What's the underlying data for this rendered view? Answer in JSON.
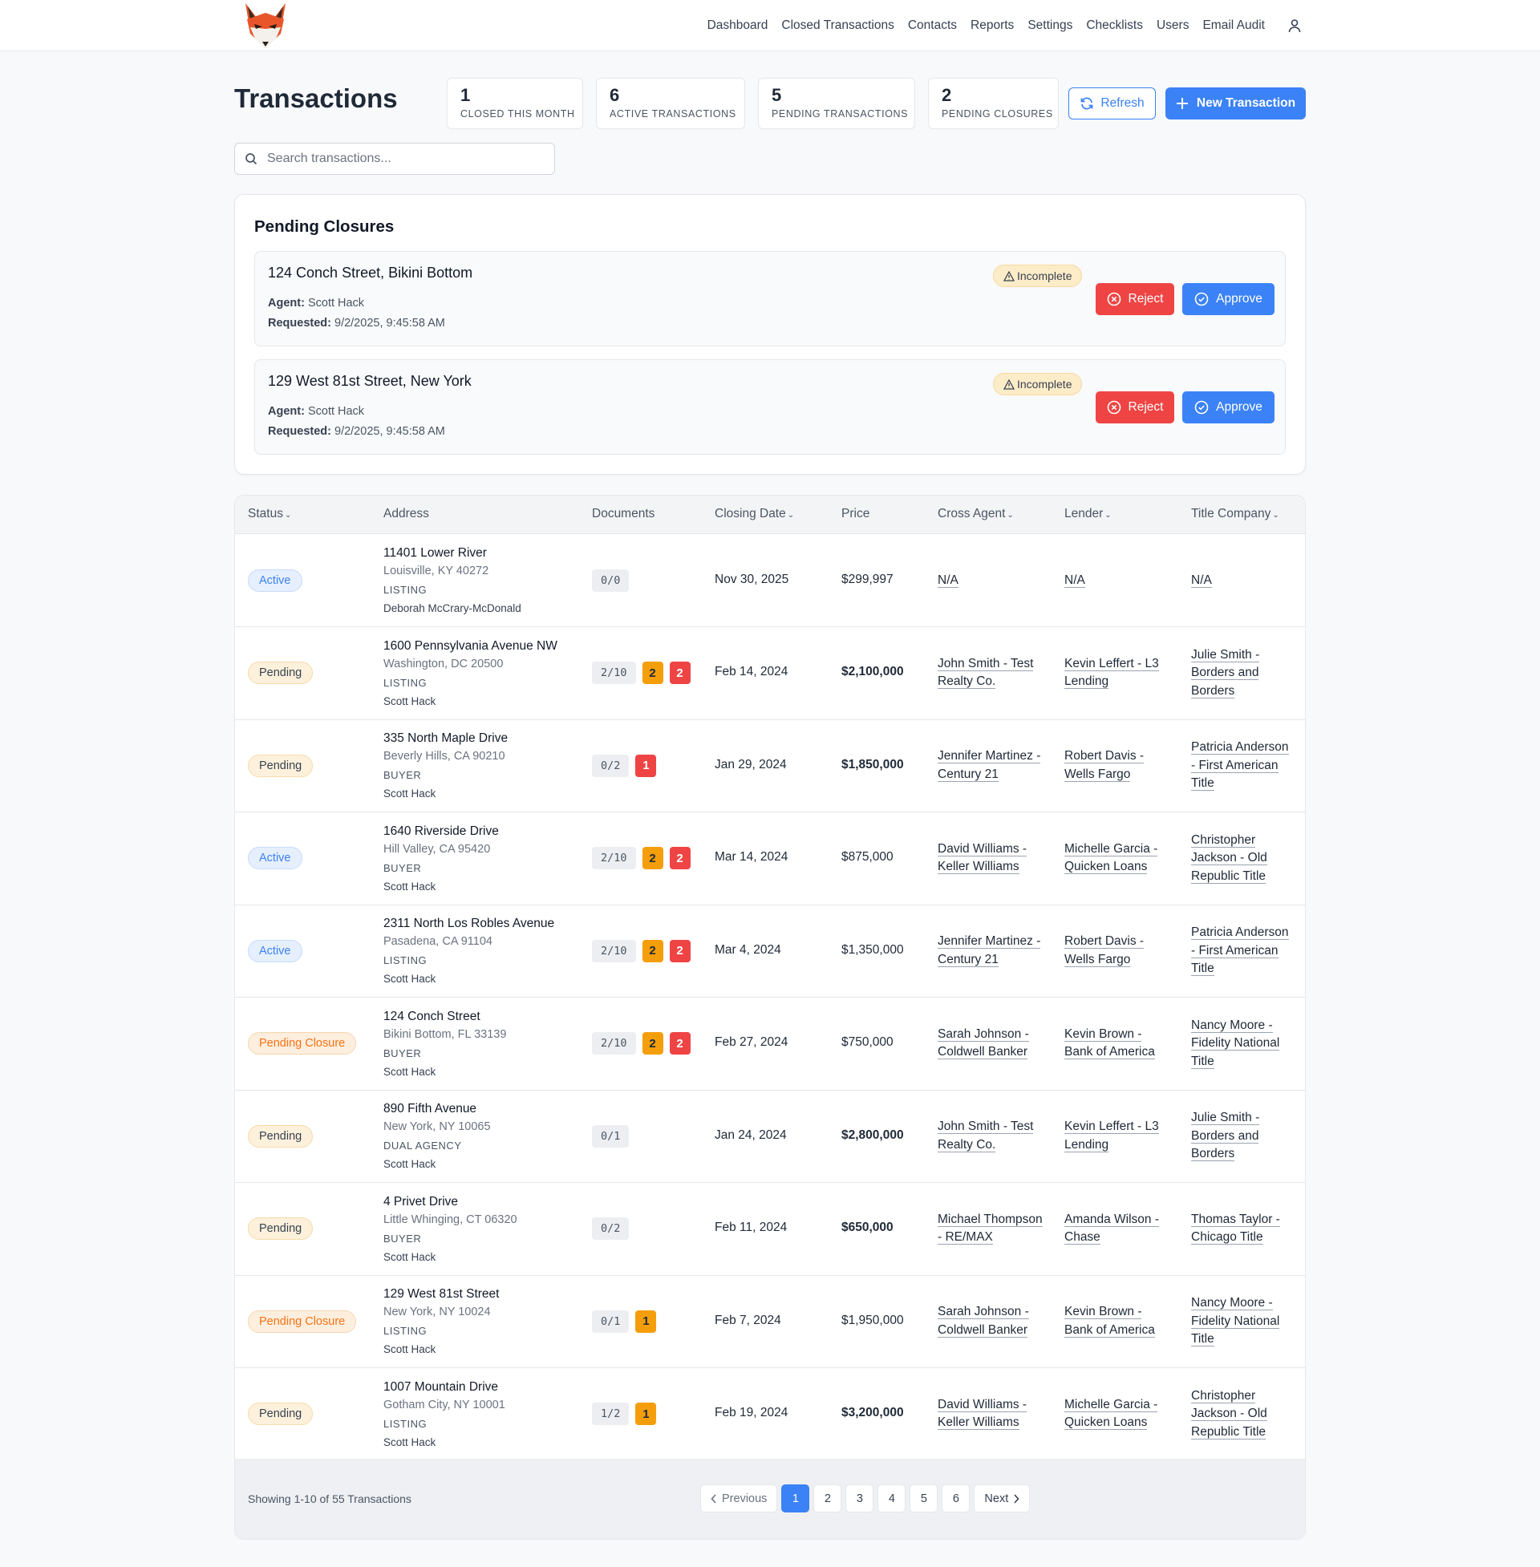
{
  "nav": {
    "items": [
      "Dashboard",
      "Closed Transactions",
      "Contacts",
      "Reports",
      "Settings",
      "Checklists",
      "Users",
      "Email Audit"
    ]
  },
  "header": {
    "title": "Transactions",
    "stats": [
      {
        "num": "1",
        "label": "CLOSED THIS MONTH"
      },
      {
        "num": "6",
        "label": "ACTIVE TRANSACTIONS"
      },
      {
        "num": "5",
        "label": "PENDING TRANSACTIONS"
      },
      {
        "num": "2",
        "label": "PENDING CLOSURES"
      }
    ],
    "refresh_label": "Refresh",
    "new_label": "New Transaction"
  },
  "search": {
    "placeholder": "Search transactions..."
  },
  "pending_closures": {
    "title": "Pending Closures",
    "agent_label": "Agent:",
    "requested_label": "Requested:",
    "badge": "Incomplete",
    "reject_label": "Reject",
    "approve_label": "Approve",
    "items": [
      {
        "address": "124 Conch Street, Bikini Bottom",
        "agent": "Scott Hack",
        "requested": "9/2/2025, 9:45:58 AM"
      },
      {
        "address": "129 West 81st Street, New York",
        "agent": "Scott Hack",
        "requested": "9/2/2025, 9:45:58 AM"
      }
    ]
  },
  "table": {
    "columns": [
      "Status",
      "Address",
      "Documents",
      "Closing Date",
      "Price",
      "Cross Agent",
      "Lender",
      "Title Company"
    ],
    "rows": [
      {
        "status": "Active",
        "addr1": "11401 Lower River",
        "addr2": "Louisville, KY 40272",
        "type": "LISTING",
        "agent": "Deborah McCrary-McDonald",
        "docs": "0/0",
        "orange": "",
        "red": "",
        "date": "Nov 30, 2025",
        "price": "$299,997",
        "bold": false,
        "cross": "N/A",
        "lender": "N/A",
        "title": "N/A"
      },
      {
        "status": "Pending",
        "addr1": "1600 Pennsylvania Avenue NW",
        "addr2": "Washington, DC 20500",
        "type": "LISTING",
        "agent": "Scott Hack",
        "docs": "2/10",
        "orange": "2",
        "red": "2",
        "date": "Feb 14, 2024",
        "price": "$2,100,000",
        "bold": true,
        "cross": "John Smith - Test Realty Co.",
        "lender": "Kevin Leffert - L3 Lending",
        "title": "Julie Smith - Borders and Borders"
      },
      {
        "status": "Pending",
        "addr1": "335 North Maple Drive",
        "addr2": "Beverly Hills, CA 90210",
        "type": "BUYER",
        "agent": "Scott Hack",
        "docs": "0/2",
        "orange": "",
        "red": "1",
        "date": "Jan 29, 2024",
        "price": "$1,850,000",
        "bold": true,
        "cross": "Jennifer Martinez - Century 21",
        "lender": "Robert Davis - Wells Fargo",
        "title": "Patricia Anderson - First American Title"
      },
      {
        "status": "Active",
        "addr1": "1640 Riverside Drive",
        "addr2": "Hill Valley, CA 95420",
        "type": "BUYER",
        "agent": "Scott Hack",
        "docs": "2/10",
        "orange": "2",
        "red": "2",
        "date": "Mar 14, 2024",
        "price": "$875,000",
        "bold": false,
        "cross": "David Williams - Keller Williams",
        "lender": "Michelle Garcia - Quicken Loans",
        "title": "Christopher Jackson - Old Republic Title"
      },
      {
        "status": "Active",
        "addr1": "2311 North Los Robles Avenue",
        "addr2": "Pasadena, CA 91104",
        "type": "LISTING",
        "agent": "Scott Hack",
        "docs": "2/10",
        "orange": "2",
        "red": "2",
        "date": "Mar 4, 2024",
        "price": "$1,350,000",
        "bold": false,
        "cross": "Jennifer Martinez - Century 21",
        "lender": "Robert Davis - Wells Fargo",
        "title": "Patricia Anderson - First American Title"
      },
      {
        "status": "Pending Closure",
        "addr1": "124 Conch Street",
        "addr2": "Bikini Bottom, FL 33139",
        "type": "BUYER",
        "agent": "Scott Hack",
        "docs": "2/10",
        "orange": "2",
        "red": "2",
        "date": "Feb 27, 2024",
        "price": "$750,000",
        "bold": false,
        "cross": "Sarah Johnson - Coldwell Banker",
        "lender": "Kevin Brown - Bank of America",
        "title": "Nancy Moore - Fidelity National Title"
      },
      {
        "status": "Pending",
        "addr1": "890 Fifth Avenue",
        "addr2": "New York, NY 10065",
        "type": "DUAL AGENCY",
        "agent": "Scott Hack",
        "docs": "0/1",
        "orange": "",
        "red": "",
        "date": "Jan 24, 2024",
        "price": "$2,800,000",
        "bold": true,
        "cross": "John Smith - Test Realty Co.",
        "lender": "Kevin Leffert - L3 Lending",
        "title": "Julie Smith - Borders and Borders"
      },
      {
        "status": "Pending",
        "addr1": "4 Privet Drive",
        "addr2": "Little Whinging, CT 06320",
        "type": "BUYER",
        "agent": "Scott Hack",
        "docs": "0/2",
        "orange": "",
        "red": "",
        "date": "Feb 11, 2024",
        "price": "$650,000",
        "bold": true,
        "cross": "Michael Thompson - RE/MAX",
        "lender": "Amanda Wilson - Chase",
        "title": "Thomas Taylor - Chicago Title"
      },
      {
        "status": "Pending Closure",
        "addr1": "129 West 81st Street",
        "addr2": "New York, NY 10024",
        "type": "LISTING",
        "agent": "Scott Hack",
        "docs": "0/1",
        "orange": "1",
        "red": "",
        "date": "Feb 7, 2024",
        "price": "$1,950,000",
        "bold": false,
        "cross": "Sarah Johnson - Coldwell Banker",
        "lender": "Kevin Brown - Bank of America",
        "title": "Nancy Moore - Fidelity National Title"
      },
      {
        "status": "Pending",
        "addr1": "1007 Mountain Drive",
        "addr2": "Gotham City, NY 10001",
        "type": "LISTING",
        "agent": "Scott Hack",
        "docs": "1/2",
        "orange": "1",
        "red": "",
        "date": "Feb 19, 2024",
        "price": "$3,200,000",
        "bold": true,
        "cross": "David Williams - Keller Williams",
        "lender": "Michelle Garcia - Quicken Loans",
        "title": "Christopher Jackson - Old Republic Title"
      }
    ]
  },
  "pagination": {
    "showing": "Showing 1-10 of 55 Transactions",
    "prev": "Previous",
    "next": "Next",
    "pages": [
      "1",
      "2",
      "3",
      "4",
      "5",
      "6"
    ],
    "current": "1"
  },
  "colors": {
    "primary": "#3b82f6",
    "danger": "#ef4444",
    "warning": "#f59e0b"
  }
}
